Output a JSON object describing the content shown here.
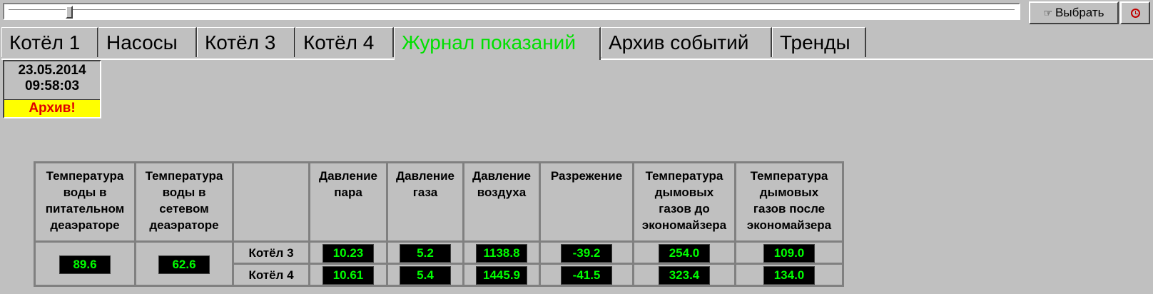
{
  "toolbar": {
    "select_label": "Выбрать",
    "select_icon": "pointing-hand-icon",
    "clock_icon": "clock-icon"
  },
  "tabs": [
    {
      "label": "Котёл 1",
      "active": false
    },
    {
      "label": "Насосы",
      "active": false
    },
    {
      "label": "Котёл 3",
      "active": false
    },
    {
      "label": "Котёл 4",
      "active": false
    },
    {
      "label": "Журнал показаний",
      "active": true
    },
    {
      "label": "Архив событий",
      "active": false
    },
    {
      "label": "Тренды",
      "active": false
    }
  ],
  "status": {
    "date": "23.05.2014",
    "time": "09:58:03",
    "archive_label": "Архив!"
  },
  "colors": {
    "active_tab": "#00e000",
    "value_bg": "#000000",
    "value_text": "#00ff00",
    "archive_bg": "#ffff00",
    "archive_text": "#e00000"
  },
  "table": {
    "headers": {
      "feed_deaerator": [
        "Температура",
        "воды в",
        "питательном",
        "деаэраторе"
      ],
      "network_deaerator": [
        "Температура",
        "воды в",
        "сетевом",
        "деаэраторе"
      ],
      "steam_pressure": [
        "Давление",
        "пара"
      ],
      "gas_pressure": [
        "Давление",
        "газа"
      ],
      "air_pressure": [
        "Давление",
        "воздуха"
      ],
      "vacuum": [
        "Разрежение"
      ],
      "flue_before": [
        "Температура",
        "дымовых",
        "газов до",
        "экономайзера"
      ],
      "flue_after": [
        "Температура",
        "дымовых",
        "газов после",
        "экономайзера"
      ]
    },
    "shared": {
      "feed_deaerator_value": "89.6",
      "network_deaerator_value": "62.6"
    },
    "rows": [
      {
        "label": "Котёл 3",
        "steam": "10.23",
        "gas": "5.2",
        "air": "1138.8",
        "vacuum": "-39.2",
        "flue_before": "254.0",
        "flue_after": "109.0"
      },
      {
        "label": "Котёл 4",
        "steam": "10.61",
        "gas": "5.4",
        "air": "1445.9",
        "vacuum": "-41.5",
        "flue_before": "323.4",
        "flue_after": "134.0"
      }
    ]
  }
}
